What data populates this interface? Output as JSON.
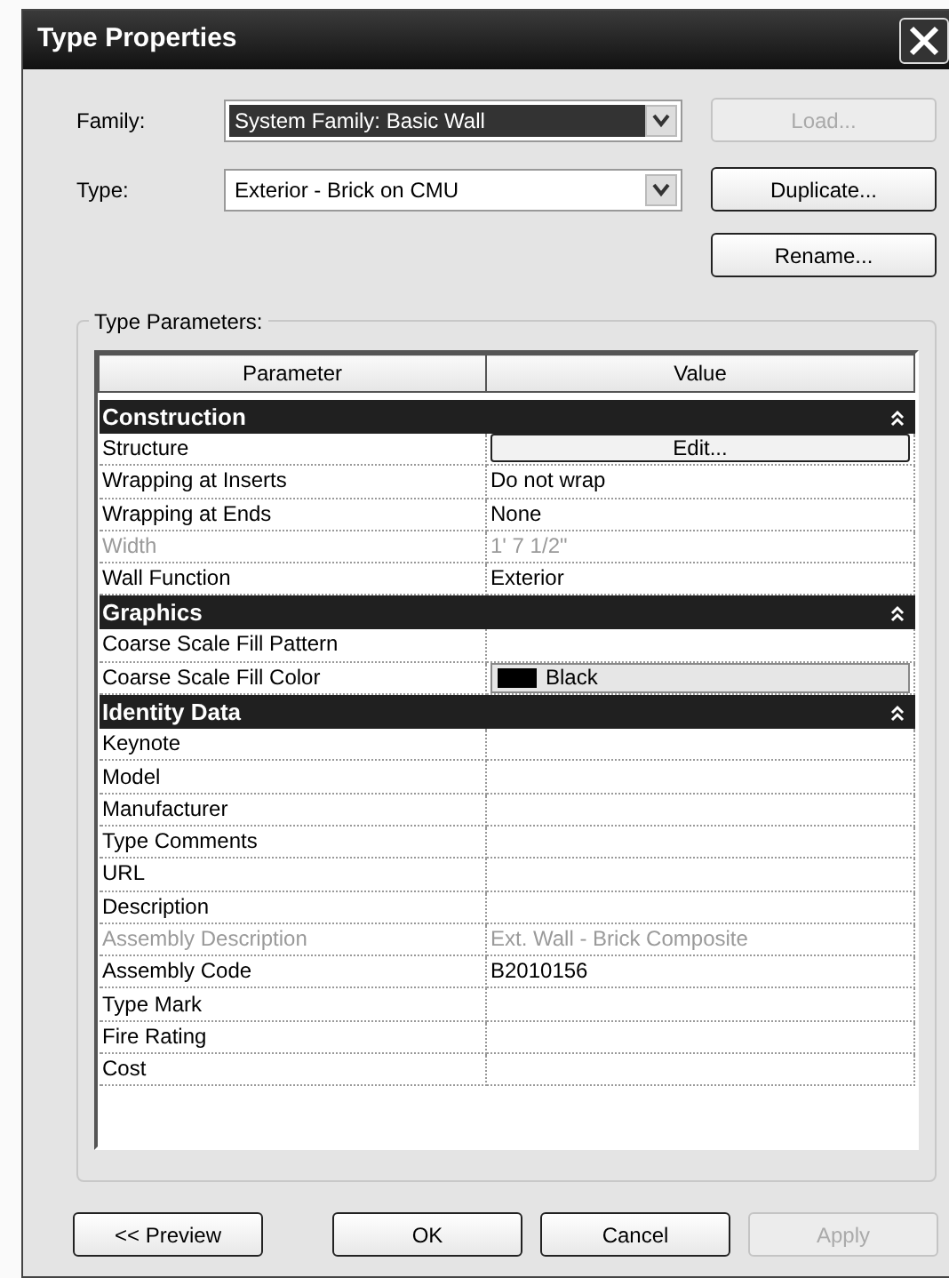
{
  "window": {
    "title": "Type Properties"
  },
  "fields": [
    {
      "label": "Family:",
      "value": "System Family: Basic Wall",
      "focused": true
    },
    {
      "label": "Type:",
      "value": "Exterior - Brick on CMU",
      "focused": false
    }
  ],
  "side_buttons": [
    {
      "label": "Load...",
      "disabled": true
    },
    {
      "label": "Duplicate...",
      "disabled": false
    },
    {
      "label": "Rename...",
      "disabled": false
    }
  ],
  "type_parameters": {
    "legend": "Type Parameters:",
    "columns": [
      "Parameter",
      "Value"
    ],
    "groups": [
      {
        "title": "Construction",
        "expanded": true,
        "rows": [
          {
            "name": "Structure",
            "kind": "button",
            "value": "Edit...",
            "disabled": false
          },
          {
            "name": "Wrapping at Inserts",
            "kind": "text",
            "value": "Do not wrap",
            "disabled": false
          },
          {
            "name": "Wrapping at Ends",
            "kind": "text",
            "value": "None",
            "disabled": false
          },
          {
            "name": "Width",
            "kind": "text",
            "value": "1'  7 1/2\"",
            "disabled": true
          },
          {
            "name": "Wall Function",
            "kind": "text",
            "value": "Exterior",
            "disabled": false
          }
        ]
      },
      {
        "title": "Graphics",
        "expanded": true,
        "rows": [
          {
            "name": "Coarse Scale Fill Pattern",
            "kind": "text",
            "disabled": false
          },
          {
            "name": "Coarse Scale Fill Color",
            "kind": "color",
            "value": "Black",
            "color": "#000000",
            "disabled": false
          }
        ]
      },
      {
        "title": "Identity Data",
        "expanded": true,
        "rows": [
          {
            "name": "Keynote",
            "kind": "text",
            "disabled": false
          },
          {
            "name": "Model",
            "kind": "text",
            "disabled": false
          },
          {
            "name": "Manufacturer",
            "kind": "text",
            "disabled": false
          },
          {
            "name": "Type Comments",
            "kind": "text",
            "disabled": false
          },
          {
            "name": "URL",
            "kind": "text",
            "disabled": false
          },
          {
            "name": "Description",
            "kind": "text",
            "disabled": false
          },
          {
            "name": "Assembly Description",
            "kind": "text",
            "value": "Ext. Wall - Brick Composite",
            "disabled": true
          },
          {
            "name": "Assembly Code",
            "kind": "text",
            "value": "B2010156",
            "disabled": false
          },
          {
            "name": "Type Mark",
            "kind": "text",
            "disabled": false
          },
          {
            "name": "Fire Rating",
            "kind": "text",
            "disabled": false
          },
          {
            "name": "Cost",
            "kind": "text",
            "disabled": false
          }
        ]
      }
    ]
  },
  "footer_buttons": [
    {
      "label": "<< Preview",
      "disabled": false
    },
    {
      "label": "OK",
      "disabled": false
    },
    {
      "label": "Cancel",
      "disabled": false
    },
    {
      "label": "Apply",
      "disabled": true
    }
  ]
}
